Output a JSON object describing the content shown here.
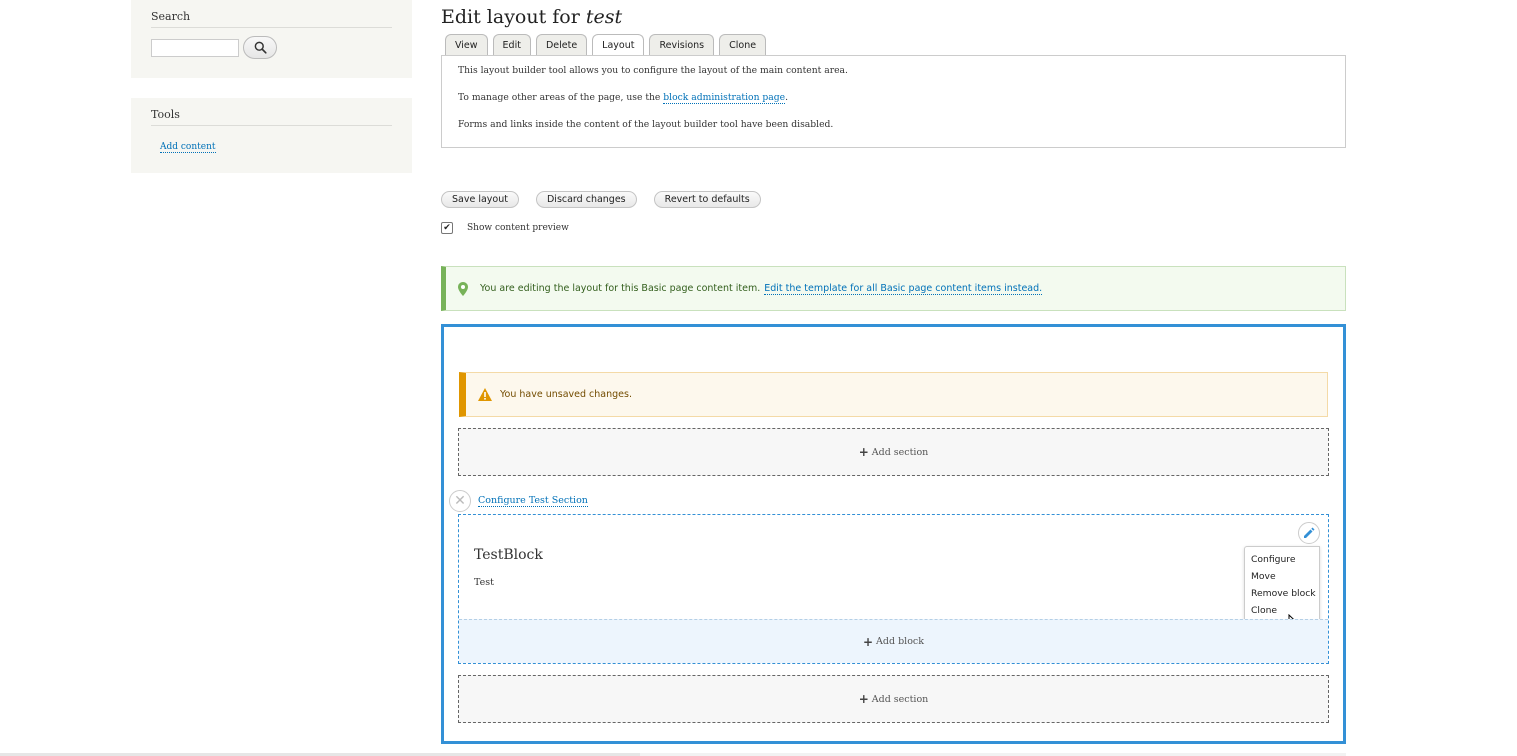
{
  "sidebar": {
    "search": {
      "title": "Search",
      "input_value": "",
      "button_icon": "search-icon"
    },
    "tools": {
      "title": "Tools",
      "links": [
        {
          "label": "Add content"
        }
      ]
    }
  },
  "main": {
    "title_prefix": "Edit layout for",
    "title_name": "test",
    "tabs": [
      {
        "label": "View"
      },
      {
        "label": "Edit"
      },
      {
        "label": "Delete"
      },
      {
        "label": "Layout",
        "active": true
      },
      {
        "label": "Revisions"
      },
      {
        "label": "Clone"
      }
    ],
    "info": {
      "line1": "This layout builder tool allows you to configure the layout of the main content area.",
      "line2_prefix": "To manage other areas of the page, use the",
      "line2_link": "block administration page",
      "line2_suffix": ".",
      "line3": "Forms and links inside the content of the layout builder tool have been disabled."
    },
    "actions": {
      "save": "Save layout",
      "discard": "Discard changes",
      "revert": "Revert to defaults"
    },
    "preview": {
      "label": "Show content preview",
      "checked": true,
      "check_glyph": "✔"
    },
    "status": {
      "message": "You are editing the layout for this Basic page content item.",
      "link": "Edit the template for all Basic page content items instead.",
      "icon": "map-pin-icon",
      "color": "#77b259"
    },
    "builder": {
      "warning": {
        "message": "You have unsaved changes.",
        "icon": "warning-icon",
        "color": "#e09600"
      },
      "add_section_label": "Add section",
      "configure_section": "Configure Test Section",
      "block": {
        "title": "TestBlock",
        "body": "Test",
        "add_block_label": "Add block",
        "contextual_menu": [
          "Configure",
          "Move",
          "Remove block",
          "Clone"
        ]
      },
      "accent_color": "#3390d6"
    }
  }
}
